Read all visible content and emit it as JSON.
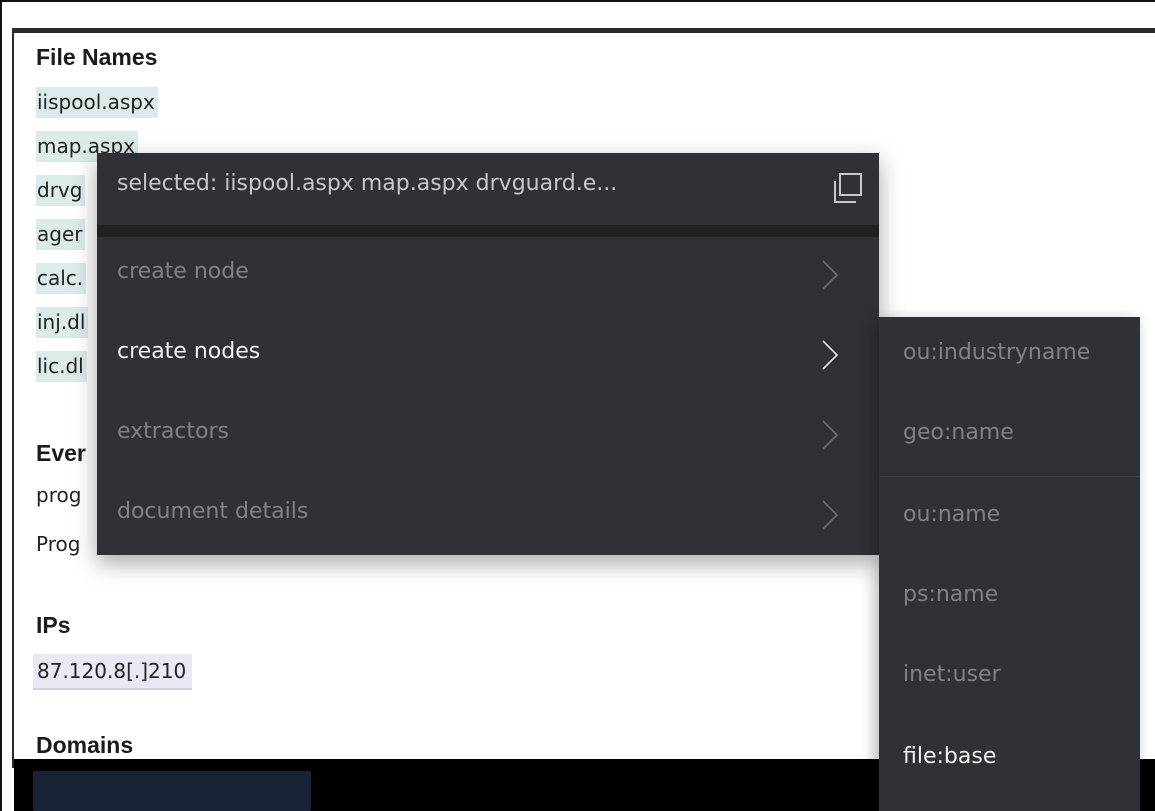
{
  "sections": {
    "file_names": {
      "heading": "File Names",
      "items": [
        "iispool.aspx",
        "map.aspx",
        "drvg",
        "ager",
        "calc.",
        "inj.dl",
        "lic.dl"
      ]
    },
    "events": {
      "heading": "Ever",
      "lines": [
        "prog",
        "Prog"
      ]
    },
    "ips": {
      "heading": "IPs",
      "items": [
        "87.120.8[.]210"
      ]
    },
    "domains": {
      "heading": "Domains"
    }
  },
  "context_menu": {
    "header": "selected: iispool.aspx map.aspx drvguard.e...",
    "copy_icon": "copy-icon",
    "items": [
      {
        "label": "create node",
        "active": false
      },
      {
        "label": "create nodes",
        "active": true
      },
      {
        "label": "extractors",
        "active": false
      },
      {
        "label": "document details",
        "active": false
      }
    ]
  },
  "submenu": {
    "items": [
      {
        "label": "ou:industryname",
        "active": false
      },
      {
        "label": "geo:name",
        "active": false
      },
      {
        "label": "ou:name",
        "active": false
      },
      {
        "label": "ps:name",
        "active": false
      },
      {
        "label": "inet:user",
        "active": false
      },
      {
        "label": "file:base",
        "active": true
      }
    ]
  },
  "colors": {
    "menu_bg": "#2e3136",
    "file_highlight": "#dcebe9",
    "ip_highlight": "#e7e9f5"
  }
}
